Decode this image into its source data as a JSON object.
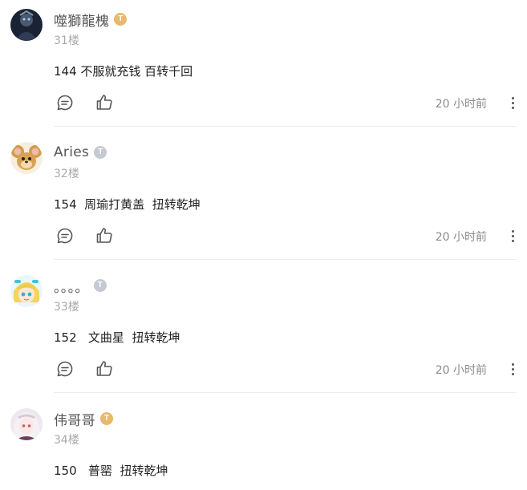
{
  "comments": [
    {
      "username": "噬獅龍槐",
      "badge_letter": "T",
      "badge_color": "#e8b86e",
      "floor": "31楼",
      "content": "144 不服就充钱 百转千回",
      "time": "20 小时前",
      "icons": {
        "comment": "comment-bubble-icon",
        "like": "thumbs-up-icon",
        "more": "more-vertical-icon"
      }
    },
    {
      "username": "Aries",
      "badge_letter": "T",
      "badge_color": "#c4c9d2",
      "floor": "32楼",
      "content": "154  周瑜打黄盖  扭转乾坤",
      "time": "20 小时前",
      "icons": {
        "comment": "comment-bubble-icon",
        "like": "thumbs-up-icon",
        "more": "more-vertical-icon"
      }
    },
    {
      "username": "。。。。",
      "badge_letter": "T",
      "badge_color": "#c4c9d2",
      "floor": "33楼",
      "content": "152   文曲星  扭转乾坤",
      "time": "20 小时前",
      "icons": {
        "comment": "comment-bubble-icon",
        "like": "thumbs-up-icon",
        "more": "more-vertical-icon"
      }
    },
    {
      "username": "伟哥哥",
      "badge_letter": "T",
      "badge_color": "#e8b86e",
      "floor": "34楼",
      "content": "150   普罂  扭转乾坤"
    }
  ]
}
